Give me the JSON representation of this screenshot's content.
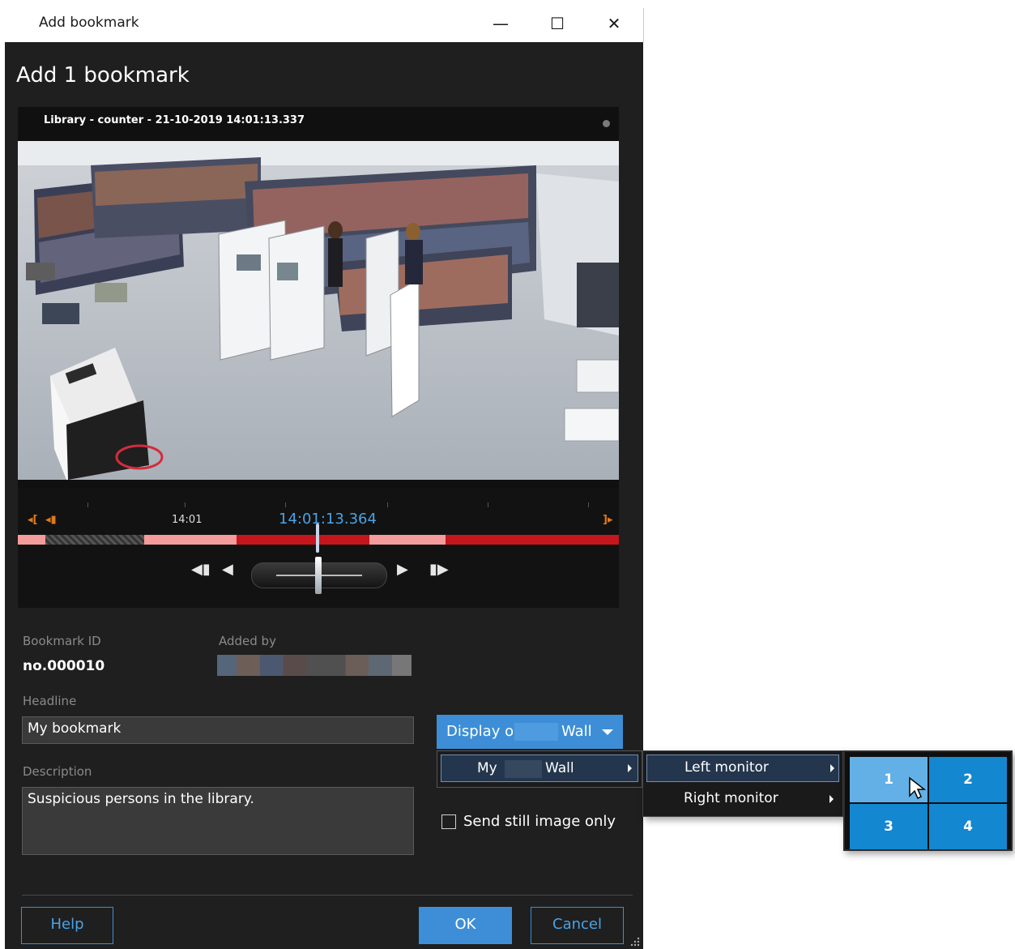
{
  "window": {
    "title": "Add bookmark",
    "minimize_icon": "—",
    "maximize_icon": "☐",
    "close_icon": "✕"
  },
  "dialog": {
    "heading": "Add 1 bookmark"
  },
  "video": {
    "camera_label": "Library - counter - 21-10-2019 14:01:13.337",
    "timeline": {
      "tick_label": "14:01",
      "cursor_time": "14:01:13.364"
    }
  },
  "fields": {
    "bookmark_id_label": "Bookmark ID",
    "bookmark_id_value": "no.000010",
    "added_by_label": "Added by",
    "headline_label": "Headline",
    "headline_value": "My bookmark",
    "description_label": "Description",
    "description_value": "Suspicious persons in the library."
  },
  "display_on": {
    "button_prefix": "Display on",
    "button_suffix": "Wall",
    "menu_item_prefix": "My",
    "menu_item_suffix": "Wall",
    "monitors": [
      "Left monitor",
      "Right monitor"
    ],
    "grid_cells": [
      "1",
      "2",
      "3",
      "4"
    ],
    "selected_cell": "1"
  },
  "send_still_image_only": {
    "label": "Send still image only",
    "checked": false
  },
  "footer": {
    "help_label": "Help",
    "ok_label": "OK",
    "cancel_label": "Cancel"
  },
  "colors": {
    "accent": "#3d8ed6",
    "recording": "#c4161c",
    "motion": "#f49b9b"
  }
}
